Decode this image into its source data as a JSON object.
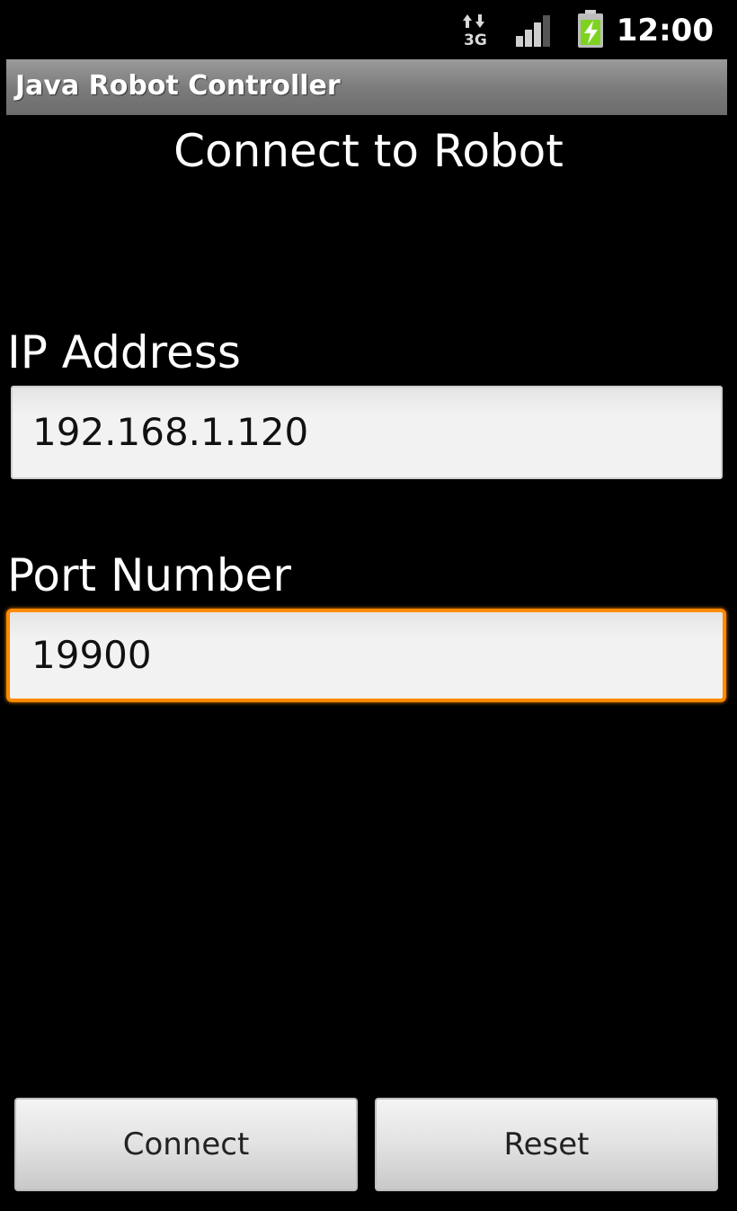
{
  "status_bar": {
    "network_type": "3G",
    "network_icon": "data-transfer-3g-icon",
    "signal_icon": "signal-strength-icon",
    "battery_icon": "battery-charging-icon",
    "time": "12:00"
  },
  "app": {
    "title": "Java Robot Controller"
  },
  "main": {
    "heading": "Connect to Robot",
    "ip_label": "IP Address",
    "ip_value": "192.168.1.120",
    "port_label": "Port Number",
    "port_value": "19900"
  },
  "buttons": {
    "connect": "Connect",
    "reset": "Reset"
  },
  "colors": {
    "focus_accent": "#ff8a00",
    "battery_green": "#7ed321"
  }
}
